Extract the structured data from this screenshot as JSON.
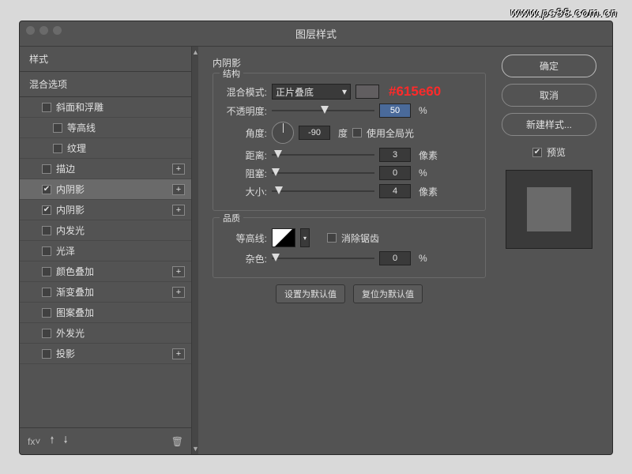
{
  "watermark": "www.ps88.com.cn",
  "dialog_title": "图层样式",
  "sidebar": {
    "header_styles": "样式",
    "header_blend": "混合选项",
    "items": [
      {
        "label": "斜面和浮雕",
        "checked": false,
        "sub": true,
        "plus": false
      },
      {
        "label": "等高线",
        "checked": false,
        "sub2": true,
        "plus": false
      },
      {
        "label": "纹理",
        "checked": false,
        "sub2": true,
        "plus": false
      },
      {
        "label": "描边",
        "checked": false,
        "sub": true,
        "plus": true
      },
      {
        "label": "内阴影",
        "checked": true,
        "sub": true,
        "plus": true,
        "selected": true
      },
      {
        "label": "内阴影",
        "checked": true,
        "sub": true,
        "plus": true
      },
      {
        "label": "内发光",
        "checked": false,
        "sub": true,
        "plus": false
      },
      {
        "label": "光泽",
        "checked": false,
        "sub": true,
        "plus": false
      },
      {
        "label": "颜色叠加",
        "checked": false,
        "sub": true,
        "plus": true
      },
      {
        "label": "渐变叠加",
        "checked": false,
        "sub": true,
        "plus": true
      },
      {
        "label": "图案叠加",
        "checked": false,
        "sub": true,
        "plus": false
      },
      {
        "label": "外发光",
        "checked": false,
        "sub": true,
        "plus": false
      },
      {
        "label": "投影",
        "checked": false,
        "sub": true,
        "plus": true
      }
    ]
  },
  "panel": {
    "title": "内阴影",
    "group_structure": "结构",
    "blend_mode_label": "混合模式:",
    "blend_mode_value": "正片叠底",
    "color_annotation": "#615e60",
    "opacity_label": "不透明度:",
    "opacity_value": "50",
    "percent": "%",
    "angle_label": "角度:",
    "angle_value": "-90",
    "angle_unit": "度",
    "global_light": "使用全局光",
    "distance_label": "距离:",
    "distance_value": "3",
    "px": "像素",
    "choke_label": "阻塞:",
    "choke_value": "0",
    "size_label": "大小:",
    "size_value": "4",
    "group_quality": "品质",
    "contour_label": "等高线:",
    "antialias": "消除锯齿",
    "noise_label": "杂色:",
    "noise_value": "0",
    "btn_default": "设置为默认值",
    "btn_reset": "复位为默认值"
  },
  "buttons": {
    "ok": "确定",
    "cancel": "取消",
    "new_style": "新建样式...",
    "preview": "预览"
  }
}
